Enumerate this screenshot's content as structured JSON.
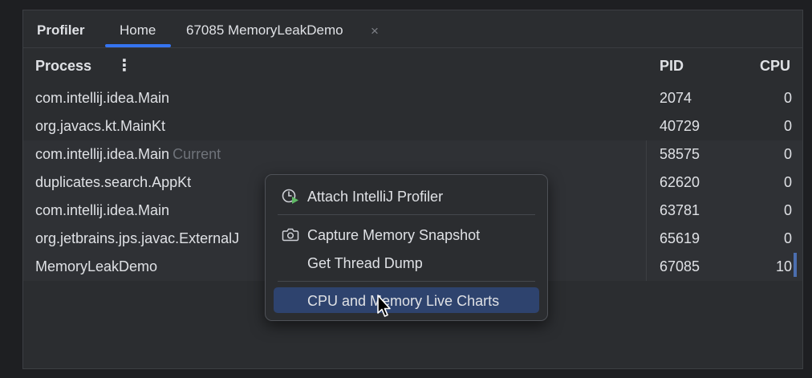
{
  "toolwindow": {
    "title": "Profiler"
  },
  "tabs": [
    {
      "label": "Home",
      "active": true
    },
    {
      "label": "67085 MemoryLeakDemo",
      "active": false,
      "closable": true,
      "close_glyph": "×"
    }
  ],
  "table": {
    "headers": {
      "process": "Process",
      "menu_glyph": "⋮",
      "pid": "PID",
      "cpu": "CPU"
    },
    "rows": [
      {
        "process": "com.intellij.idea.Main",
        "suffix": "",
        "pid": "2074",
        "cpu": "0"
      },
      {
        "process": "org.javacs.kt.MainKt",
        "suffix": "",
        "pid": "40729",
        "cpu": "0"
      },
      {
        "process": "com.intellij.idea.Main",
        "suffix": "Current",
        "pid": "58575",
        "cpu": "0"
      },
      {
        "process": "duplicates.search.AppKt",
        "suffix": "",
        "pid": "62620",
        "cpu": "0"
      },
      {
        "process": "com.intellij.idea.Main",
        "suffix": "",
        "pid": "63781",
        "cpu": "0"
      },
      {
        "process": "org.jetbrains.jps.javac.ExternalJ",
        "suffix": "",
        "pid": "65619",
        "cpu": "0"
      },
      {
        "process": "MemoryLeakDemo",
        "suffix": "",
        "pid": "67085",
        "cpu": "10"
      }
    ]
  },
  "context_menu": {
    "items": [
      {
        "label": "Attach IntelliJ Profiler",
        "icon": "profiler-attach-icon"
      },
      {
        "label": "Capture Memory Snapshot",
        "icon": "camera-icon"
      },
      {
        "label": "Get Thread Dump",
        "icon": ""
      },
      {
        "label": "CPU and Memory Live Charts",
        "icon": "",
        "highlighted": true
      }
    ]
  },
  "colors": {
    "accent": "#3574f0",
    "highlight": "#2e436e",
    "background": "#2b2d30",
    "run_green": "#5fb865"
  }
}
